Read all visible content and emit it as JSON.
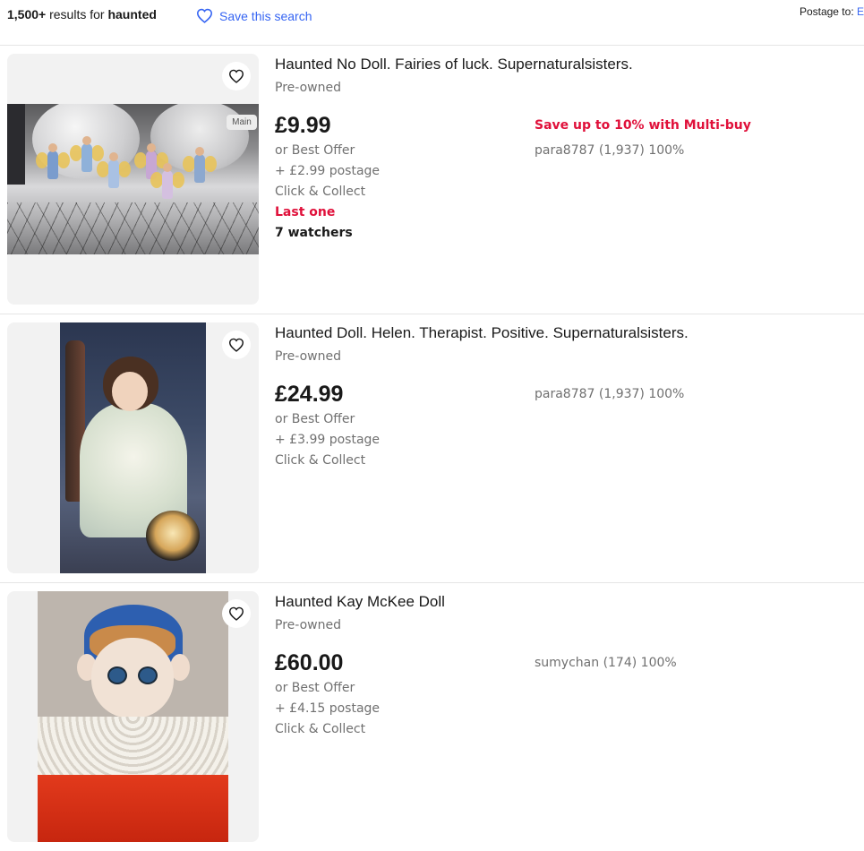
{
  "header": {
    "results_count": "1,500+",
    "results_text": " results for ",
    "query": "haunted",
    "save_search_label": "Save this search",
    "postage_to_label": "Postage to: ",
    "postage_to_location": "E"
  },
  "items": [
    {
      "title": "Haunted No Doll. Fairies of luck. Supernaturalsisters.",
      "condition": "Pre-owned",
      "price": "£9.99",
      "best_offer": "or Best Offer",
      "postage": "+ £2.99 postage",
      "collect": "Click & Collect",
      "stock": "Last one",
      "watchers": "7 watchers",
      "promo": "Save up to 10% with Multi-buy",
      "seller": "para8787 (1,937) 100%",
      "image_badge": "Main"
    },
    {
      "title": "Haunted Doll. Helen. Therapist. Positive. Supernaturalsisters.",
      "condition": "Pre-owned",
      "price": "£24.99",
      "best_offer": "or Best Offer",
      "postage": "+ £3.99 postage",
      "collect": "Click & Collect",
      "seller": "para8787 (1,937) 100%"
    },
    {
      "title": "Haunted Kay McKee Doll",
      "condition": "Pre-owned",
      "price": "£60.00",
      "best_offer": "or Best Offer",
      "postage": "+ £4.15 postage",
      "collect": "Click & Collect",
      "seller": "sumychan (174) 100%"
    }
  ],
  "colors": {
    "link": "#3665f3",
    "urgent": "#e0103a",
    "text": "#191919",
    "muted": "#707070"
  },
  "icons": {
    "save_search": "heart-outline-icon",
    "watchlist": "heart-outline-icon"
  }
}
